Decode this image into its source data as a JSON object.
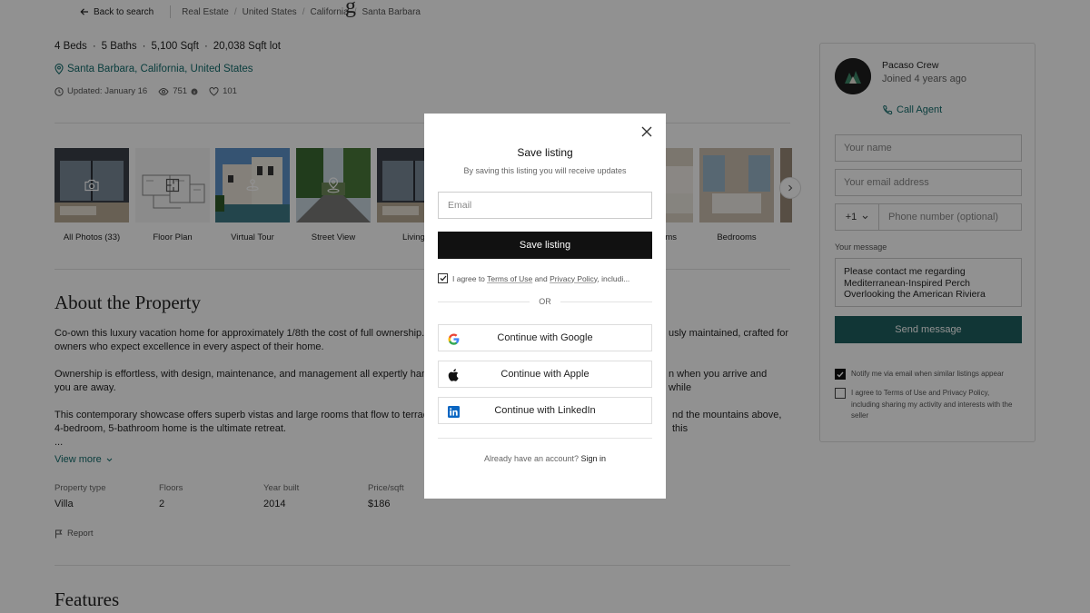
{
  "header": {
    "back_label": "Back to search",
    "breadcrumbs": [
      "Real Estate",
      "United States",
      "California",
      "Santa Barbara"
    ],
    "title_fragment": "g"
  },
  "listing": {
    "specs": [
      "4 Beds",
      "5 Baths",
      "5,100 Sqft",
      "20,038 Sqft lot"
    ],
    "location": "Santa Barbara, California, United States",
    "updated": "Updated: January 16",
    "views": "751",
    "likes": "101"
  },
  "gallery": {
    "items": [
      {
        "label": "All Photos (33)",
        "icon": "camera-icon"
      },
      {
        "label": "Floor Plan",
        "icon": "floor-plan-icon"
      },
      {
        "label": "Virtual Tour",
        "icon": "virtual-tour-icon"
      },
      {
        "label": "Street View",
        "icon": "street-view-icon"
      },
      {
        "label": "Living",
        "icon": ""
      },
      {
        "label": "ms",
        "icon": ""
      },
      {
        "label": "Bedrooms",
        "icon": ""
      }
    ]
  },
  "about": {
    "heading": "About the Property",
    "p1a": "Co-own this luxury vacation home for approximately 1/8th the cost of full ownership. E",
    "p1b": "usly maintained, crafted for",
    "p1c": "owners who expect excellence in every aspect of their home.",
    "p2a": "Ownership is effortless, with design, maintenance, and management all expertly handl",
    "p2b": "n when you arrive and while",
    "p2c": "you are away.",
    "p3a": "This contemporary showcase offers superb vistas and large rooms that flow to terrace",
    "p3b": "nd the mountains above, this",
    "p3c": "4-bedroom, 5-bathroom home is the ultimate retreat.",
    "ellipsis": "...",
    "view_more": "View more",
    "facts": [
      {
        "k": "Property type",
        "v": "Villa"
      },
      {
        "k": "Floors",
        "v": "2"
      },
      {
        "k": "Year built",
        "v": "2014"
      },
      {
        "k": "Price/sqft",
        "v": "$186"
      }
    ],
    "report": "Report",
    "features_heading": "Features"
  },
  "sidebar": {
    "agent_name": "Pacaso Crew",
    "agent_joined": "Joined 4 years ago",
    "call_label": "Call Agent",
    "name_placeholder": "Your name",
    "email_placeholder": "Your email address",
    "country_code": "+1",
    "phone_placeholder": "Phone number (optional)",
    "message_label": "Your message",
    "message_value": "Please contact me regarding Mediterranean-Inspired Perch Overlooking the American Riviera",
    "send_label": "Send message",
    "notify_label": "Notify me via email when similar listings appear",
    "notify_checked": true,
    "agree_label": "I agree to Terms of Use and Privacy Policy, including sharing my activity and interests with the seller",
    "agree_checked": false
  },
  "modal": {
    "title": "Save listing",
    "subtitle": "By saving this listing you will receive updates",
    "email_placeholder": "Email",
    "save_label": "Save listing",
    "agree_prefix": "I agree to ",
    "terms": "Terms of Use",
    "and": " and ",
    "privacy": "Privacy Policy",
    "agree_suffix": ", includi...",
    "or": "OR",
    "google": "Continue with Google",
    "apple": "Continue with Apple",
    "linkedin": "Continue with LinkedIn",
    "signin_prefix": "Already have an account?",
    "signin": "Sign in"
  },
  "colors": {
    "accent": "#146d6d",
    "send_button": "#1f5f5f",
    "overlay": "rgba(0,0,0,0.43)"
  }
}
